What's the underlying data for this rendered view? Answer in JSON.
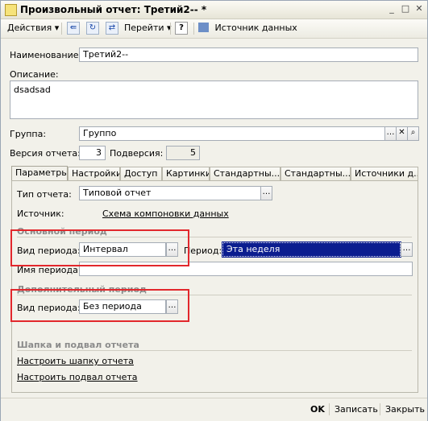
{
  "window": {
    "title": "Произвольный отчет: Третий2-- *"
  },
  "toolbar": {
    "actions_label": "Действия",
    "goto_label": "Перейти",
    "help_label": "?",
    "datasource_label": "Источник данных"
  },
  "form": {
    "name_label": "Наименование:",
    "name_value": "Третий2--",
    "description_label": "Описание:",
    "description_value": "dsadsad",
    "group_label": "Группа:",
    "group_value": "Группо",
    "version_label": "Версия отчета:",
    "version_value": "3",
    "subversion_label": "Подверсия:",
    "subversion_value": "5"
  },
  "tabs": [
    {
      "label": "Параметры"
    },
    {
      "label": "Настройки"
    },
    {
      "label": "Доступ"
    },
    {
      "label": "Картинки"
    },
    {
      "label": "Стандартны..."
    },
    {
      "label": "Стандартны..."
    },
    {
      "label": "Источники д..."
    }
  ],
  "params": {
    "report_type_label": "Тип отчета:",
    "report_type_value": "Типовой отчет",
    "source_label": "Источник:",
    "source_link": "Схема компоновки данных",
    "main_period_title": "Основной период",
    "period_kind_label": "Вид периода:",
    "period_kind_value": "Интервал",
    "period_label": "Период:",
    "period_value": "Эта неделя",
    "period_name_label": "Имя периода:",
    "period_name_value": "",
    "extra_period_title": "Дополнительный период",
    "extra_period_kind_label": "Вид периода:",
    "extra_period_kind_value": "Без периода",
    "header_footer_title": "Шапка и подвал отчета",
    "setup_header_link": "Настроить шапку отчета",
    "setup_footer_link": "Настроить подвал отчета"
  },
  "footer": {
    "ok_label": "OK",
    "save_label": "Записать",
    "close_label": "Закрыть"
  },
  "colors": {
    "highlight": "#e2272c",
    "selection": "#0b1d8f"
  }
}
